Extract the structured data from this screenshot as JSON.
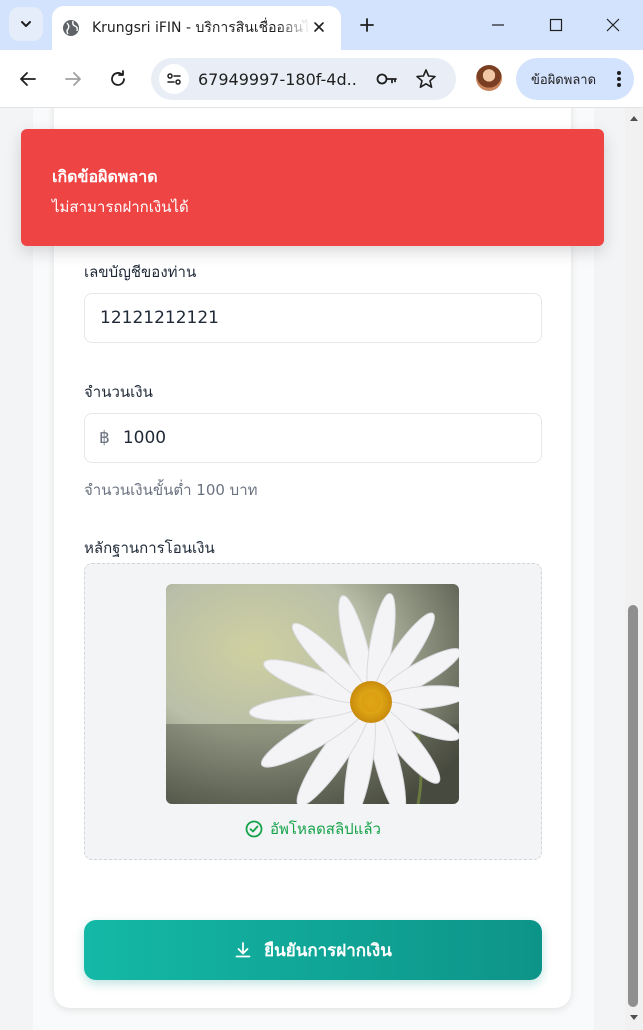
{
  "browser": {
    "tab_title": "Krungsri iFIN - บริการสินเชื่อออนไลน์",
    "url": "67949997-180f-4d...",
    "profile_label": "ข้อผิดพลาด"
  },
  "toast": {
    "title": "เกิดข้อผิดพลาด",
    "message": "ไม่สามารถฝากเงินได้"
  },
  "form": {
    "account": {
      "label": "เลขบัญชีของท่าน",
      "value": "12121212121"
    },
    "amount": {
      "label": "จำนวนเงิน",
      "currency_symbol": "฿",
      "value": "1000",
      "hint": "จำนวนเงินขั้นต่ำ 100 บาท"
    },
    "slip": {
      "label": "หลักฐานการโอนเงิน",
      "status": "อัพโหลดสลิปแล้ว"
    },
    "submit_label": "ยืนยันการฝากเงิน"
  },
  "colors": {
    "toast_bg": "#ef4444",
    "accent": "#14b8a6",
    "success": "#16a34a",
    "tabstrip": "#d3e3fd"
  },
  "icons": [
    "chevron-down-icon",
    "globe-icon",
    "close-icon",
    "plus-icon",
    "minimize-icon",
    "maximize-icon",
    "back-icon",
    "forward-icon",
    "reload-icon",
    "site-info-icon",
    "key-icon",
    "star-icon",
    "kebab-menu-icon",
    "check-circle-icon",
    "download-icon"
  ]
}
